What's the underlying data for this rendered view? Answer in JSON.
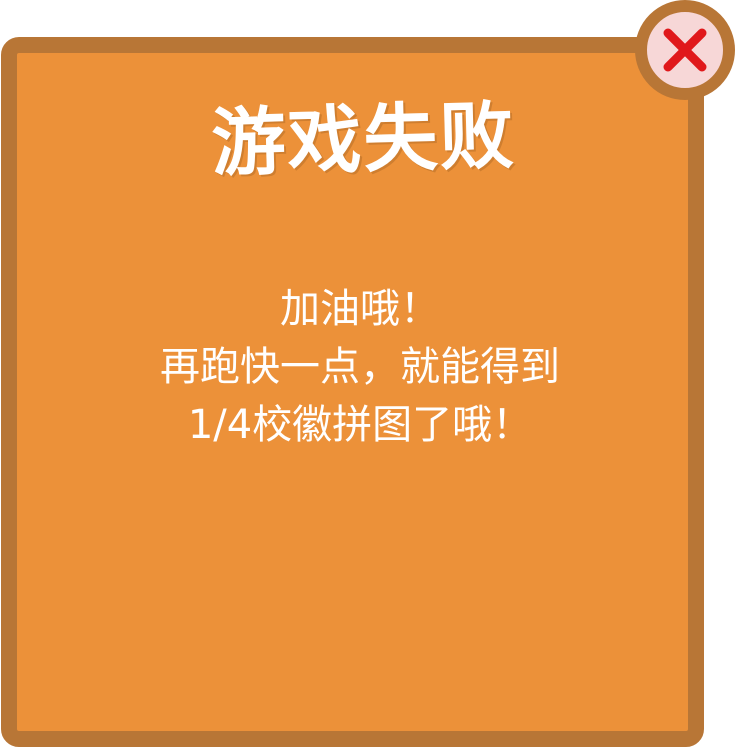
{
  "dialog": {
    "title": "游戏失败",
    "message_lines": [
      "加油哦！",
      "再跑快一点，就能得到",
      "1/4校徽拼图了哦！"
    ]
  },
  "close_button": {
    "icon": "close-icon",
    "icon_color": "#e0181b"
  },
  "colors": {
    "panel": "#ec9139",
    "border": "#b87636",
    "close_bg": "#f7d7d7",
    "text": "#ffffff"
  }
}
